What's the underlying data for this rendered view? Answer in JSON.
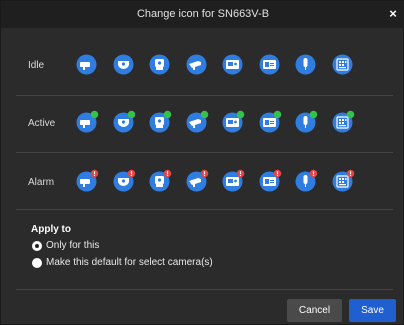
{
  "dialog": {
    "title": "Change icon for SN663V-B",
    "close_glyph": "×"
  },
  "rows": [
    {
      "label": "Idle",
      "status": "none"
    },
    {
      "label": "Active",
      "status": "active-dot"
    },
    {
      "label": "Alarm",
      "status": "alarm-dot"
    }
  ],
  "icon_types": [
    "bullet-camera-icon",
    "dome-camera-icon",
    "ptz-camera-icon",
    "box-camera-icon",
    "panorama-camera-icon",
    "encoder-icon",
    "microphone-icon",
    "io-device-icon"
  ],
  "colors": {
    "icon_blue": "#2f7de1",
    "active_dot": "#35c24a",
    "alarm_dot": "#e04646",
    "save_button": "#1f5fcf"
  },
  "apply": {
    "title": "Apply to",
    "options": [
      {
        "label": "Only for this",
        "selected": true
      },
      {
        "label": "Make this default for select camera(s)",
        "selected": false
      }
    ]
  },
  "buttons": {
    "cancel": "Cancel",
    "save": "Save"
  }
}
